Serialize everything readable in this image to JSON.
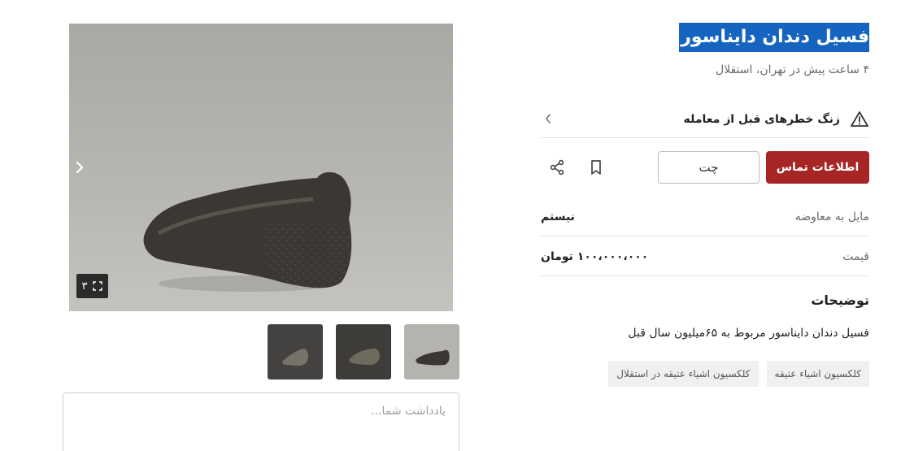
{
  "listing": {
    "title": "فسیل دندان دایناسور",
    "subtitle": "۴ ساعت پیش در تهران، استقلال"
  },
  "warning": {
    "text": "زنگ خطرهای قبل از معامله",
    "icon": "warning-icon"
  },
  "actions": {
    "contact_label": "اطلاعات تماس",
    "chat_label": "چت",
    "bookmark_icon": "bookmark-icon",
    "share_icon": "share-icon",
    "accent_color": "#a62626"
  },
  "details": [
    {
      "label": "مایل به معاوضه",
      "value": "نیستم"
    },
    {
      "label": "قیمت",
      "value": "۱۰۰،۰۰۰،۰۰۰ تومان"
    }
  ],
  "description": {
    "heading": "توضیحات",
    "text": "فسیل دندان دایناسور مربوط به ۶۵میلیون سال قبل"
  },
  "tags": [
    "کلکسیون اشیاء عتیقه",
    "کلکسیون اشیاء عتیقه در استقلال"
  ],
  "gallery": {
    "photo_count": "۳",
    "expand_icon": "expand-icon",
    "next_icon": "chevron-right-icon"
  },
  "note": {
    "placeholder": "یادداشت شما..."
  }
}
